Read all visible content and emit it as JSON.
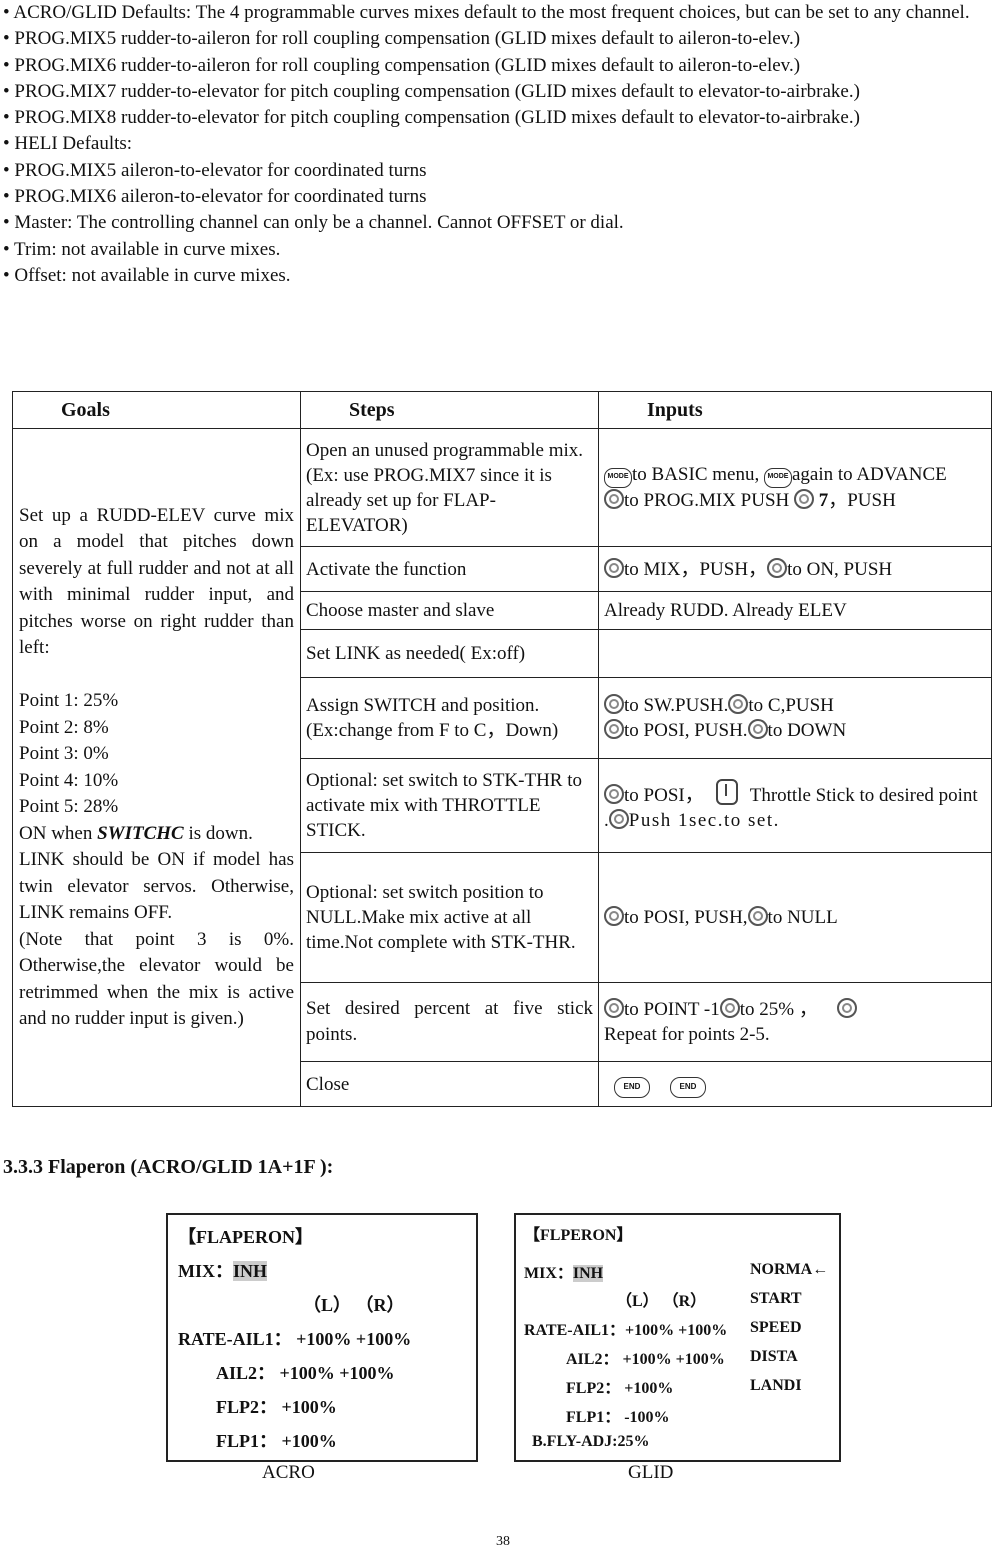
{
  "bullets": [
    "• ACRO/GLID Defaults: The 4 programmable curves mixes default to the most frequent choices, but can be set to any channel.",
    "• PROG.MIX5 rudder-to-aileron for roll coupling compensation (GLID mixes default to aileron-to-elev.)",
    "• PROG.MIX6 rudder-to-aileron for roll coupling compensation (GLID mixes default to aileron-to-elev.)",
    "• PROG.MIX7 rudder-to-elevator for pitch coupling compensation (GLID mixes default to elevator-to-airbrake.)",
    "• PROG.MIX8 rudder-to-elevator for pitch coupling compensation (GLID mixes default to elevator-to-airbrake.)",
    "• HELI Defaults:",
    "• PROG.MIX5 aileron-to-elevator for coordinated turns",
    "• PROG.MIX6 aileron-to-elevator for coordinated turns",
    "• Master: The controlling channel can only be a channel. Cannot OFFSET or dial.",
    "• Trim: not available in curve mixes.",
    "• Offset: not available in curve mixes."
  ],
  "table": {
    "headers": [
      "Goals",
      "Steps",
      "Inputs"
    ],
    "goal": {
      "intro": "Set up a RUDD-ELEV curve mix on a model that pitches down severely at full rudder and not at all with minimal rudder input, and pitches worse on right rudder than left:",
      "points": [
        "Point 1: 25%",
        "Point 2: 8%",
        "Point 3: 0%",
        "Point 4: 10%",
        "Point 5: 28%"
      ],
      "on_when": "ON when ",
      "switch": "SWITCHC",
      "is_down": " is down.",
      "link": "LINK should be ON if model has twin elevator servos. Otherwise, LINK remains OFF.",
      "note": "(Note that point 3 is 0%. Otherwise,the elevator would be retrimmed when the mix is active and no rudder input is given.)"
    },
    "steps": [
      "Open an unused programmable mix.(Ex: use PROG.MIX7 since it is already set up for FLAP-ELEVATOR)",
      "Activate the function",
      "Choose master and slave",
      "Set LINK as needed( Ex:off)",
      "Assign SWITCH and position.(Ex:change from F to C，Down)",
      "Optional: set switch to STK-THR to activate mix with THROTTLE STICK.",
      "Optional: set switch position to NULL.Make mix active at all time.Not complete with STK-THR.",
      "Set desired percent at five stick points.",
      "Close"
    ],
    "inputs": {
      "r1a": "to BASIC menu, ",
      "r1b": "again to ADVANCE",
      "r1c": "to PROG.MIX PUSH ",
      "r1d": " 7",
      "r1e": "，PUSH",
      "r2a": "to MIX，PUSH，",
      "r2b": "to ON, PUSH",
      "r3": "Already RUDD. Already ELEV",
      "r5a": "to SW.PUSH.",
      "r5b": "to C,PUSH",
      "r5c": "to POSI, PUSH.",
      "r5d": "to DOWN",
      "r6a": "to POSI，",
      "r6b": "Throttle Stick to desired point .",
      "r6c": "Push 1sec.to set.",
      "r7a": "to POSI, PUSH,",
      "r7b": "to NULL",
      "r8a": "to POINT -1",
      "r8b": "to 25% ，",
      "r8c": "Repeat for points 2-5.",
      "mode_label": "MODE",
      "end_label": "END"
    }
  },
  "section_title": "3.3.3 Flaperon (ACRO/GLID 1A+1F ):",
  "acro": {
    "title": "【FLAPERON】",
    "mix": "MIX：",
    "mix_val": "INH",
    "lr": "（L）   （R）",
    "rows": [
      "RATE-AIL1： +100% +100%",
      "AIL2： +100% +100%",
      "FLP2： +100%",
      "FLP1： +100%"
    ],
    "caption": "ACRO"
  },
  "glid": {
    "title": "【FLPERON】",
    "mix": "MIX：",
    "mix_val": "INH",
    "lr": "（L）   （R）",
    "rows": [
      "RATE-AIL1：+100% +100%",
      "AIL2： +100% +100%",
      "FLP2： +100%",
      "FLP1： -100%"
    ],
    "adj": "B.FLY-ADJ:25%",
    "modes": [
      "NORMA←",
      "START",
      "SPEED",
      "DISTA",
      "LANDI"
    ],
    "caption": "GLID"
  },
  "page_number": "38"
}
